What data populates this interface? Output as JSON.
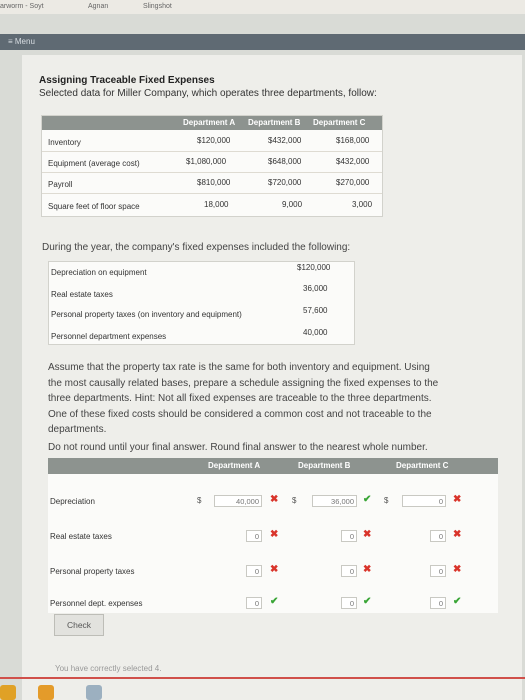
{
  "topbar": {
    "items": [
      "arworm - Soyt",
      "Agnan",
      "Slingshot"
    ]
  },
  "menu": {
    "label": "≡ Menu"
  },
  "header": {
    "title": "Assigning Traceable Fixed Expenses",
    "subtitle": "Selected data for Miller Company, which operates three departments, follow:"
  },
  "data_table": {
    "columns": [
      "Department A",
      "Department B",
      "Department C"
    ],
    "rows": [
      {
        "label": "Inventory",
        "values": [
          "$120,000",
          "$432,000",
          "$168,000"
        ]
      },
      {
        "label": "Equipment (average cost)",
        "values": [
          "$1,080,000",
          "$648,000",
          "$432,000"
        ]
      },
      {
        "label": "Payroll",
        "values": [
          "$810,000",
          "$720,000",
          "$270,000"
        ]
      },
      {
        "label": "Square feet of floor space",
        "values": [
          "18,000",
          "9,000",
          "3,000"
        ]
      }
    ]
  },
  "fixed_intro": "During the year, the company's fixed expenses included the following:",
  "fixed_expenses": [
    {
      "label": "Depreciation on equipment",
      "value": "$120,000"
    },
    {
      "label": "Real estate taxes",
      "value": "36,000"
    },
    {
      "label": "Personal property taxes (on inventory and equipment)",
      "value": "57,600"
    },
    {
      "label": "Personnel department expenses",
      "value": "40,000"
    }
  ],
  "instructions": [
    "Assume that the property tax rate is the same for both inventory and equipment. Using",
    "the most causally related bases, prepare a schedule assigning the fixed expenses to the",
    "three departments. Hint: Not all fixed expenses are traceable to the three departments.",
    "One of these fixed costs should be considered a common cost and not traceable to the",
    "departments."
  ],
  "rounding_note": "Do not round until your final answer. Round final answer to the nearest whole number.",
  "answer_table": {
    "columns": [
      "Department A",
      "Department B",
      "Department C"
    ],
    "currency_symbol": "$",
    "rows": [
      {
        "label": "Depreciation",
        "values": [
          "40,000",
          "36,000",
          "0"
        ],
        "marks": [
          "x",
          "check",
          "x"
        ]
      },
      {
        "label": "Real estate taxes",
        "values": [
          "0",
          "0",
          "0"
        ],
        "marks": [
          "x",
          "x",
          "x"
        ]
      },
      {
        "label": "Personal property taxes",
        "values": [
          "0",
          "0",
          "0"
        ],
        "marks": [
          "x",
          "x",
          "x"
        ]
      },
      {
        "label": "Personnel dept. expenses",
        "values": [
          "0",
          "0",
          "0"
        ],
        "marks": [
          "check",
          "check",
          "check"
        ]
      }
    ]
  },
  "check_label": "Check",
  "status_text": "You have correctly selected 4."
}
